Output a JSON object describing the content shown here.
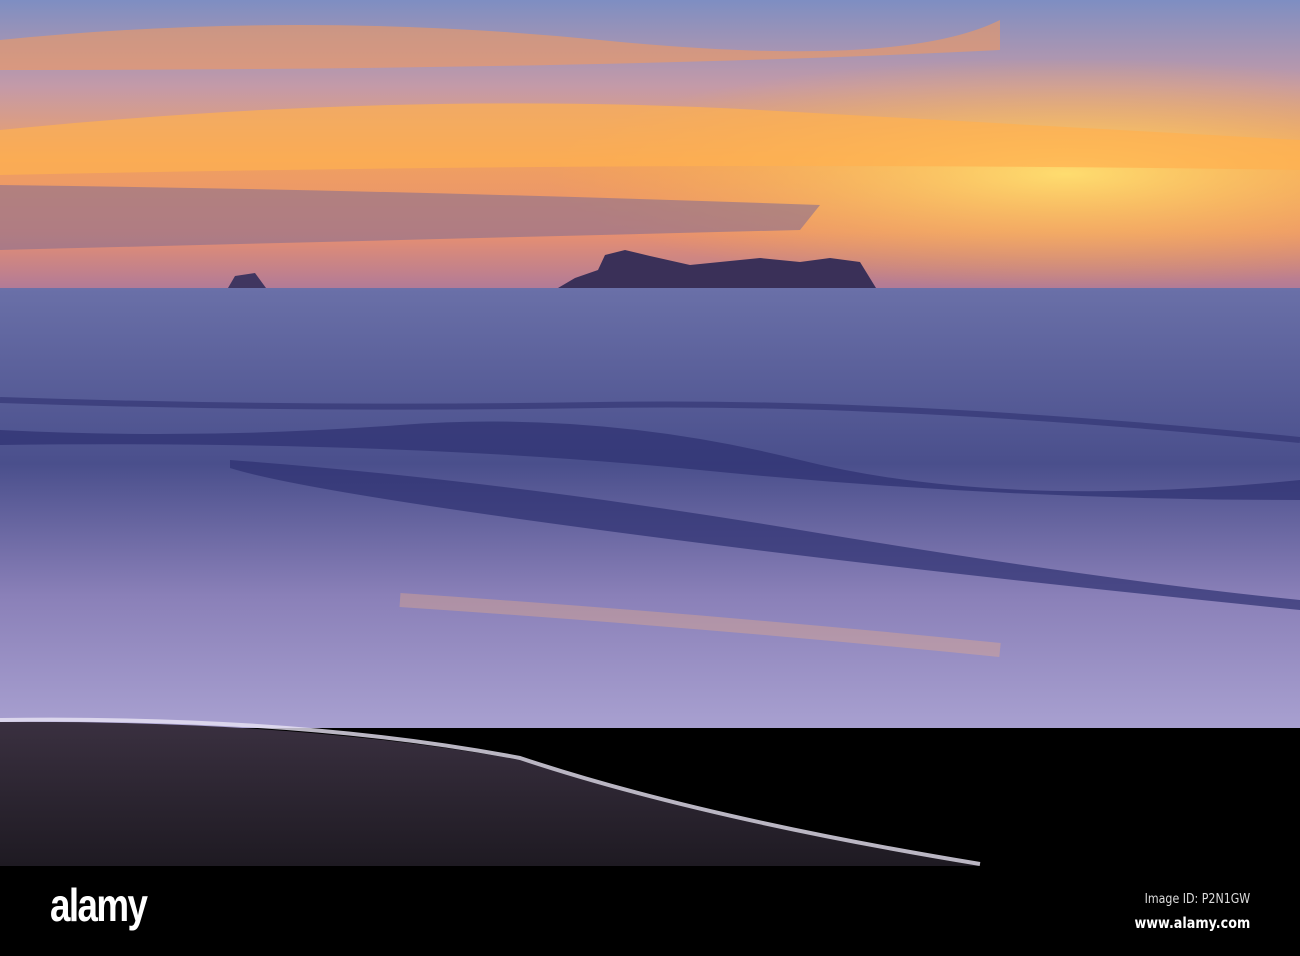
{
  "photo": {
    "subject": "sunset over sea with island silhouette and waves on beach",
    "colors": {
      "sky_top": "#7f8fc0",
      "sky_glow": "#ffb040",
      "sea": "#5a5f9a",
      "sand": "#2a2430"
    }
  },
  "watermark": {
    "logo": "alamy",
    "image_id": "Image ID: P2N1GW",
    "site": "www.alamy.com"
  }
}
